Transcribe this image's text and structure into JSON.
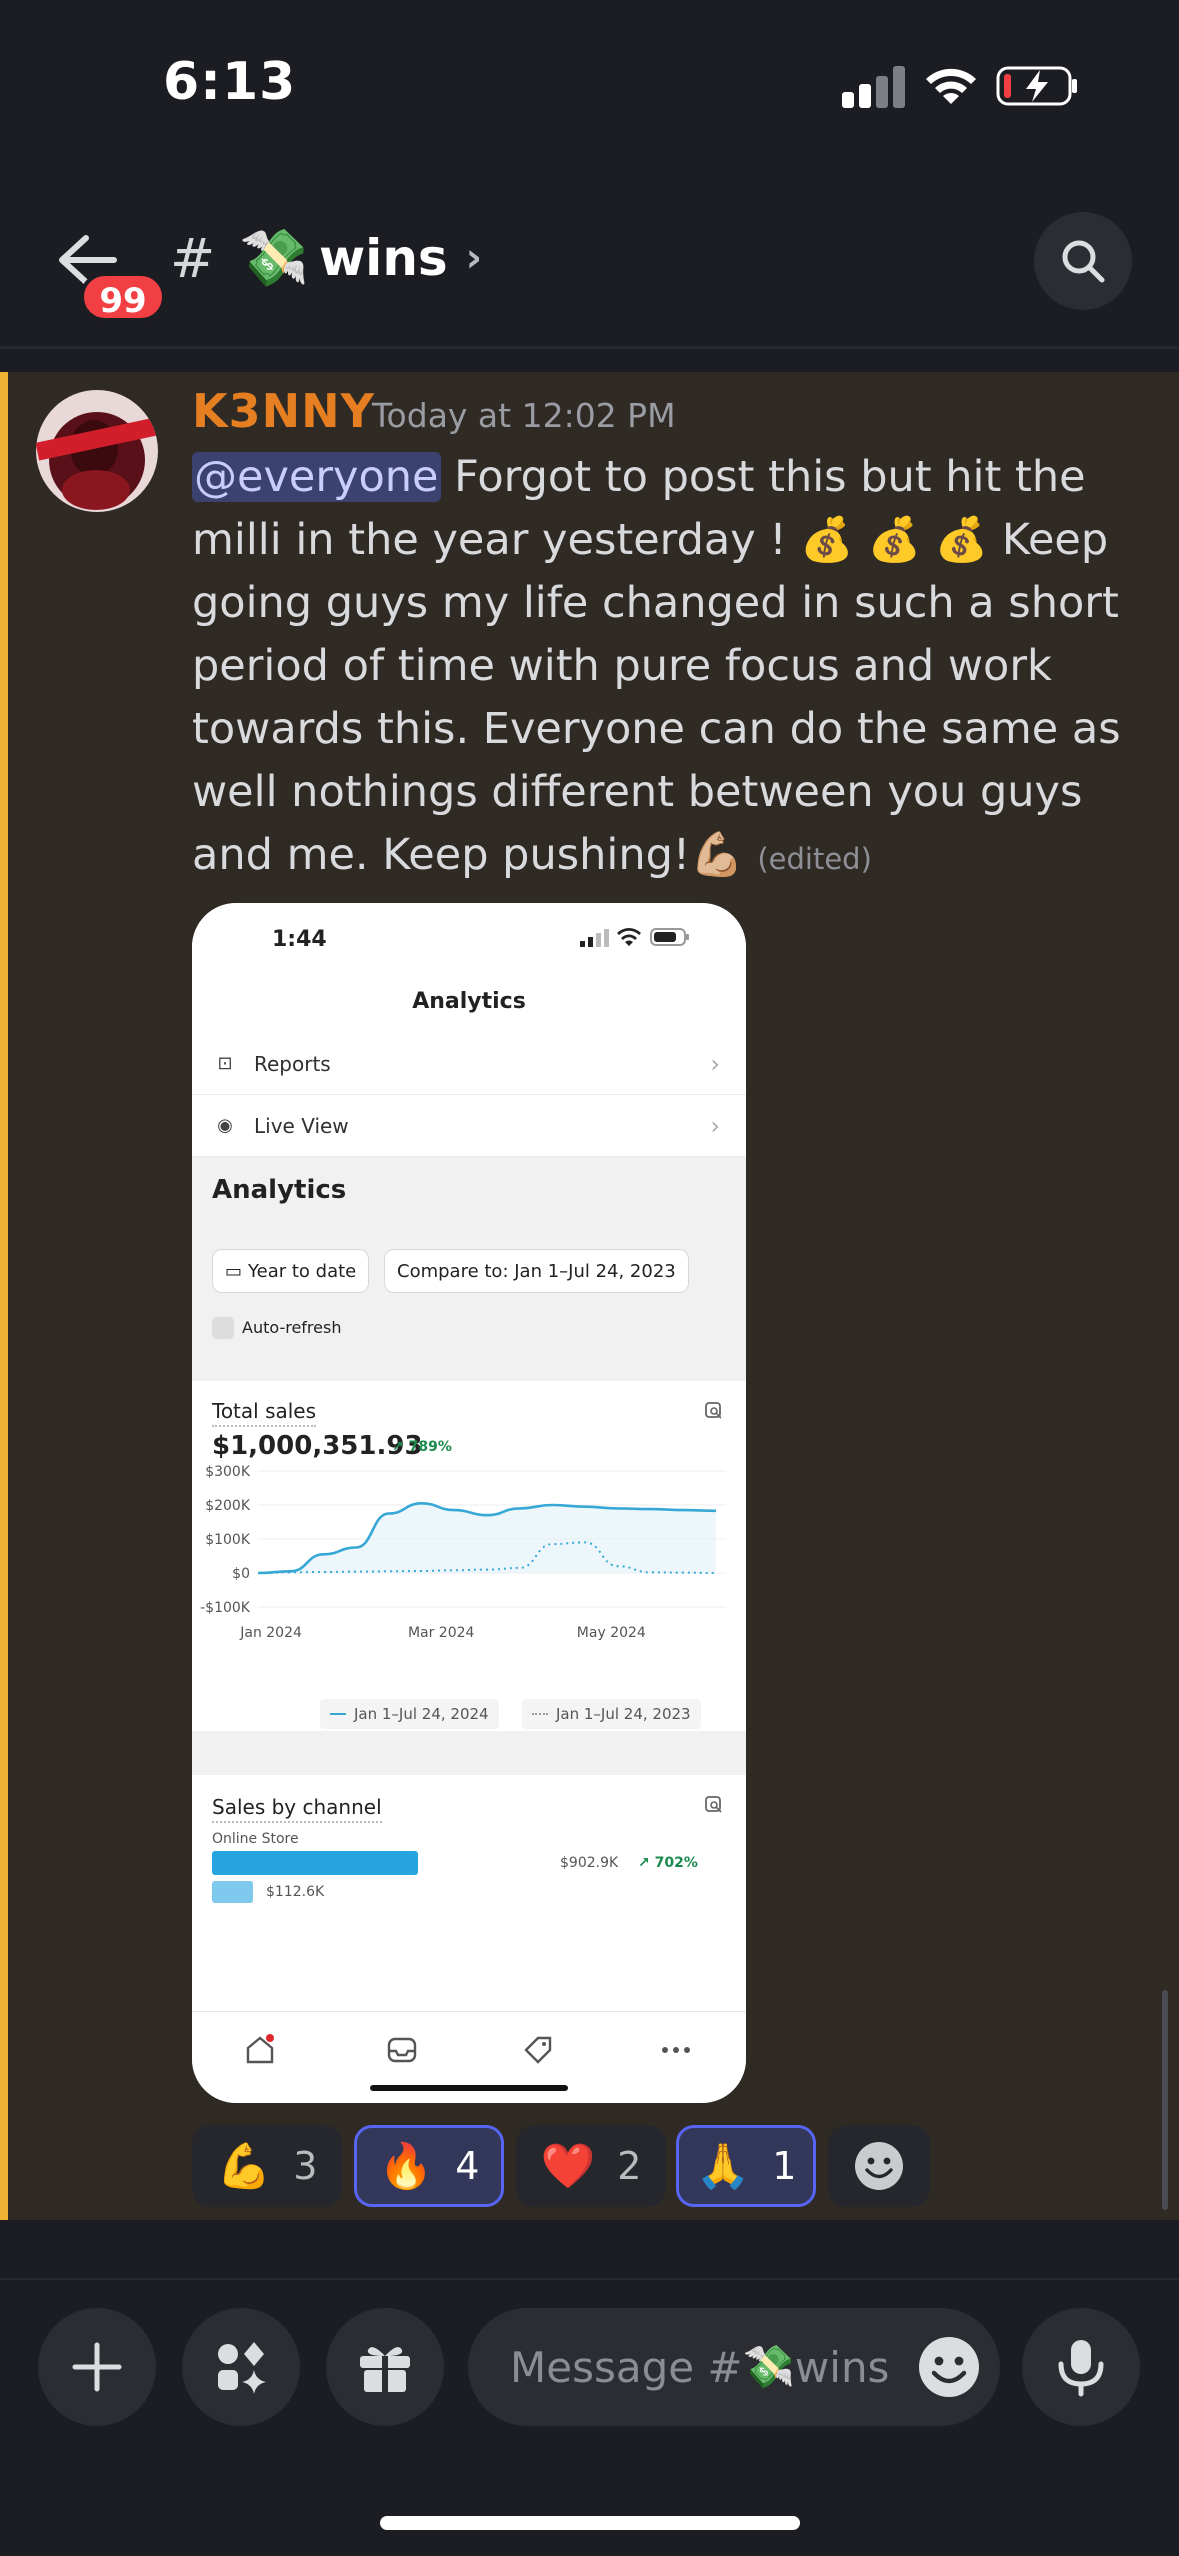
{
  "status_bar": {
    "time": "6:13"
  },
  "header": {
    "back_badge": "99",
    "hash": "#",
    "channel_emoji": "💸",
    "channel_name": "wins",
    "chevron": "›"
  },
  "message": {
    "author": "K3NNY",
    "timestamp": "Today at 12:02 PM",
    "mention": "@everyone",
    "text": " Forgot to post this but hit the milli in the year yesterday ! 💰 💰 💰 Keep going guys my life changed in such a short period of time with pure focus and work towards this. Everyone can do the same as well nothings different between you guys and me.  Keep pushing!💪🏼",
    "edited": "(edited)",
    "author_color": "#e67e22"
  },
  "attachment": {
    "status_time": "1:44",
    "title": "Analytics",
    "menu": [
      {
        "label": "Reports",
        "arrow": "›"
      },
      {
        "label": "Live View",
        "arrow": "›"
      }
    ],
    "section_title": "Analytics",
    "filter_date": "Year to date",
    "filter_compare": "Compare to: Jan 1–Jul 24, 2023",
    "auto_refresh": "Auto-refresh",
    "total_sales_label": "Total sales",
    "total_sales_value": "$1,000,351.93",
    "total_sales_pct": "↗ 789%",
    "legend_current": "Jan 1–Jul 24, 2024",
    "legend_previous": "Jan 1–Jul 24, 2023",
    "channel_label": "Sales by channel",
    "channel_sub": "Online Store",
    "channel_value": "$902.9K",
    "channel_pct": "↗ 702%",
    "channel_prev_value": "$112.6K",
    "channel_current_share": 1.0,
    "channel_prev_share": 0.125
  },
  "chart_data": {
    "type": "line",
    "ytick_labels": [
      "$300K",
      "$200K",
      "$100K",
      "$0",
      "-$100K"
    ],
    "yticks": [
      300,
      200,
      100,
      0,
      -100
    ],
    "xtick_labels": [
      "Jan 2024",
      "Mar 2024",
      "May 2024"
    ],
    "x": [
      0,
      0.5,
      1,
      1.5,
      2,
      2.5,
      3,
      3.5,
      4,
      4.5,
      5,
      5.5,
      6,
      6.5,
      7
    ],
    "series": [
      {
        "name": "Jan 1–Jul 24, 2024",
        "style": "solid",
        "color": "#37a8d6",
        "values": [
          0,
          5,
          55,
          75,
          175,
          205,
          185,
          170,
          190,
          200,
          195,
          190,
          188,
          185,
          183
        ]
      },
      {
        "name": "Jan 1–Jul 24, 2023",
        "style": "dotted",
        "color": "#37a8d6",
        "values": [
          0,
          2,
          3,
          4,
          5,
          6,
          8,
          10,
          15,
          85,
          90,
          20,
          2,
          1,
          0
        ]
      }
    ],
    "ylim": [
      -100,
      300
    ]
  },
  "reactions": [
    {
      "emoji": "💪",
      "count": "3",
      "active": false
    },
    {
      "emoji": "🔥",
      "count": "4",
      "active": true
    },
    {
      "emoji": "❤️",
      "count": "2",
      "active": false
    },
    {
      "emoji": "🙏",
      "count": "1",
      "active": true
    }
  ],
  "composer": {
    "placeholder_prefix": "Message #",
    "placeholder_emoji": "💸",
    "placeholder_suffix": "wins"
  }
}
